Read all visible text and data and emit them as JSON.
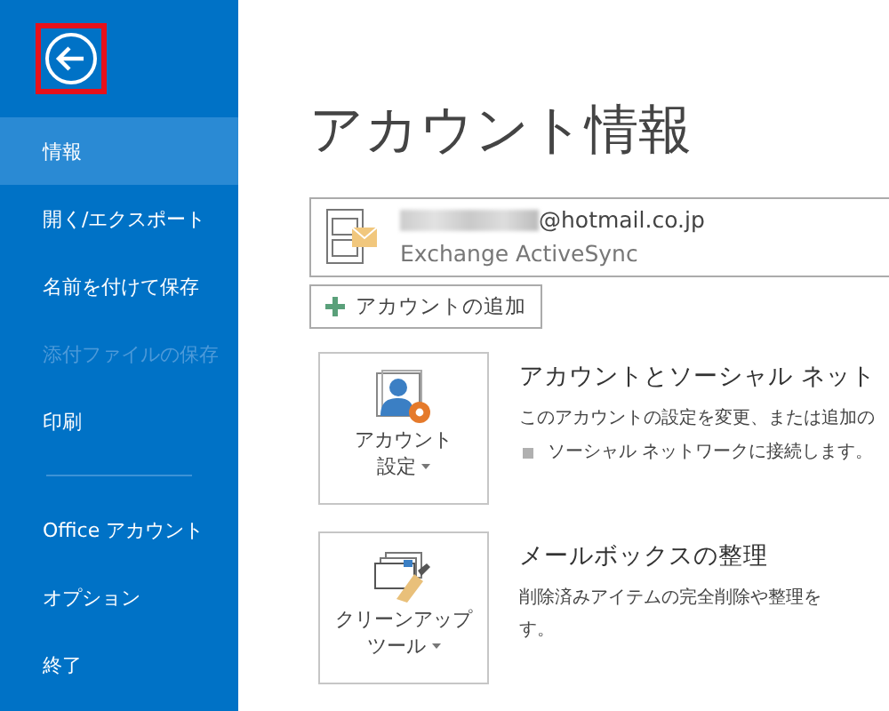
{
  "back_button": {
    "highlighted": true
  },
  "sidebar": {
    "items": [
      {
        "label": "情報",
        "selected": true,
        "disabled": false
      },
      {
        "label": "開く/エクスポート",
        "selected": false,
        "disabled": false
      },
      {
        "label": "名前を付けて保存",
        "selected": false,
        "disabled": false
      },
      {
        "label": "添付ファイルの保存",
        "selected": false,
        "disabled": true
      },
      {
        "label": "印刷",
        "selected": false,
        "disabled": false
      },
      {
        "kind": "divider"
      },
      {
        "label": "Office アカウント",
        "selected": false,
        "disabled": false
      },
      {
        "label": "オプション",
        "selected": false,
        "disabled": false
      },
      {
        "label": "終了",
        "selected": false,
        "disabled": false
      }
    ]
  },
  "page_title": "アカウント情報",
  "account": {
    "email": "@hotmail.co.jp",
    "email_redacted": true,
    "type": "Exchange ActiveSync"
  },
  "add_account_button": "アカウントの追加",
  "sections": [
    {
      "kind": "account",
      "button_lines": [
        "アカウント",
        "設定"
      ],
      "heading": "アカウントとソーシャル ネット",
      "lines": [
        "このアカウントの設定を変更、または追加の"
      ],
      "bullets": [
        "ソーシャル ネットワークに接続します。"
      ]
    },
    {
      "kind": "cleanup",
      "button_lines": [
        "クリーンアップ",
        "ツール"
      ],
      "heading": "メールボックスの整理",
      "lines": [
        "削除済みアイテムの完全削除や整理を",
        "す。"
      ]
    }
  ]
}
